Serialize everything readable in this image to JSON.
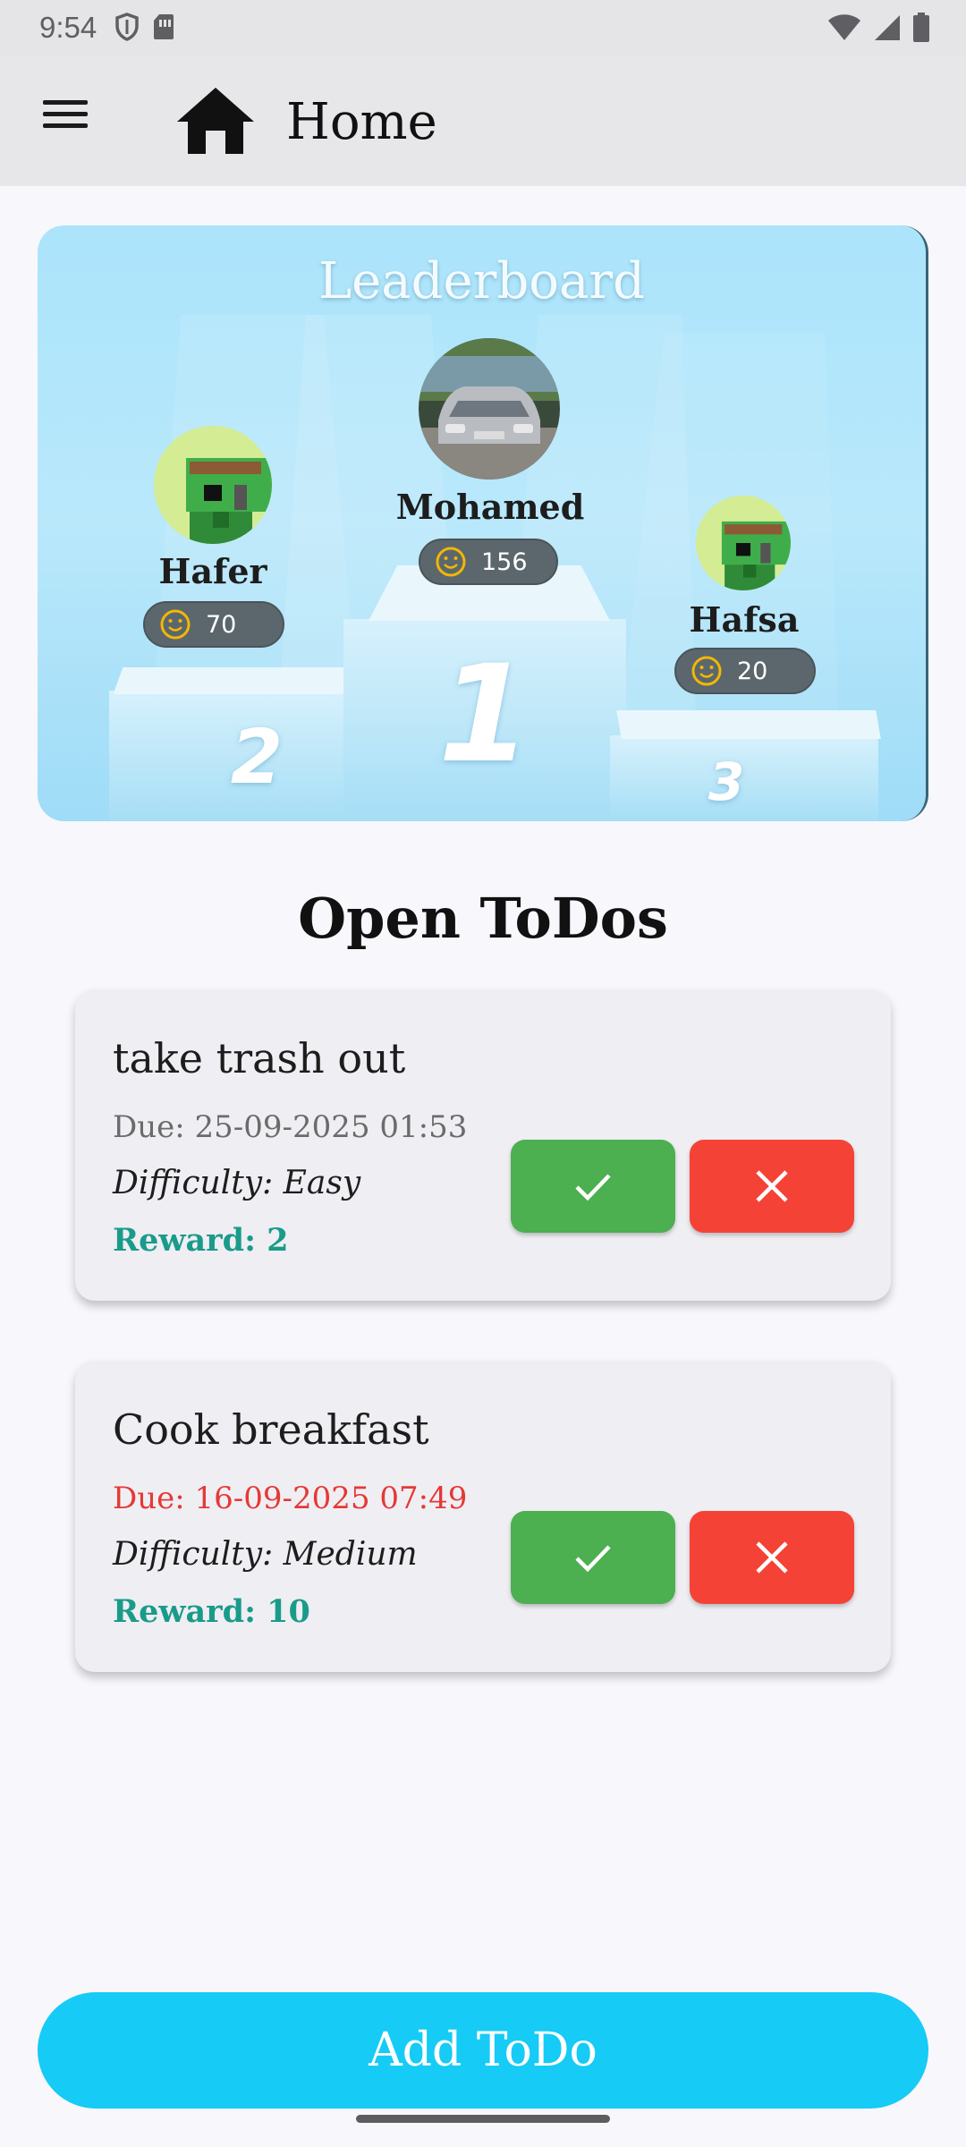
{
  "status_bar": {
    "time": "9:54",
    "left_icons": [
      "shield-icon",
      "sim-card-icon"
    ],
    "right_icons": [
      "wifi-icon",
      "signal-icon",
      "battery-icon"
    ]
  },
  "app_bar": {
    "title": "Home",
    "menu_icon": "menu-icon",
    "title_icon": "home-icon"
  },
  "leaderboard": {
    "title": "Leaderboard",
    "places": [
      {
        "rank": "1",
        "name": "Mohamed",
        "score": "156",
        "avatar": "car-photo"
      },
      {
        "rank": "2",
        "name": "Hafer",
        "score": "70",
        "avatar": "pixel-character"
      },
      {
        "rank": "3",
        "name": "Hafsa",
        "score": "20",
        "avatar": "pixel-character"
      }
    ],
    "score_icon": "smiley-coin-icon"
  },
  "todos": {
    "section_title": "Open ToDos",
    "items": [
      {
        "title": "take trash out",
        "due": "Due: 25-09-2025 01:53",
        "overdue": false,
        "difficulty": "Difficulty: Easy",
        "reward": "Reward: 2"
      },
      {
        "title": "Cook breakfast",
        "due": "Due: 16-09-2025 07:49",
        "overdue": true,
        "difficulty": "Difficulty: Medium",
        "reward": "Reward: 10"
      }
    ],
    "accept_icon": "check-icon",
    "reject_icon": "close-icon"
  },
  "add_button": {
    "label": "Add ToDo"
  },
  "colors": {
    "accent": "#16cbf6",
    "accept": "#4caf50",
    "reject": "#f44336",
    "reward": "#1a9b8a",
    "overdue": "#e53935"
  }
}
